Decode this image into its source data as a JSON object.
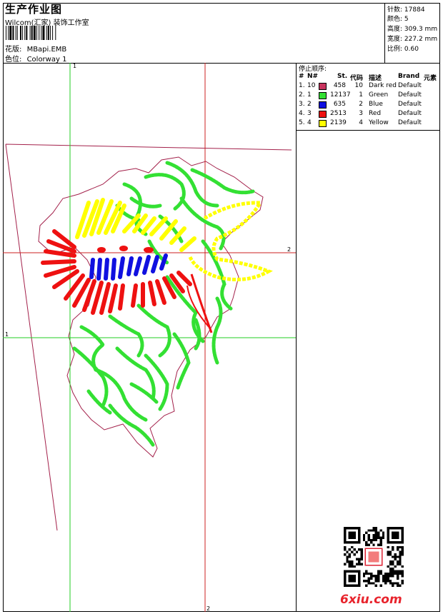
{
  "header": {
    "title": "生产作业图",
    "company": "Wilcom(汇家) 装饰工作室",
    "pattern_label": "花版:",
    "pattern_value": "MBapi.EMB",
    "colorway_label": "色位:",
    "colorway_value": "Colorway 1"
  },
  "stats": {
    "stitches_label": "针数:",
    "stitches_value": "17884",
    "colors_label": "颜色:",
    "colors_value": "5",
    "height_label": "高度:",
    "height_value": "309.3 mm",
    "width_label": "宽度:",
    "width_value": "227.2 mm",
    "scale_label": "比例:",
    "scale_value": "0.60"
  },
  "guides": {
    "v_green_label": "1",
    "h_green_label": "1",
    "h_red_label": "2",
    "v_red_label": "2"
  },
  "thread_table": {
    "title": "停止顺序:",
    "headers": {
      "index": "#",
      "n": "N#",
      "st": "St.",
      "code": "代码",
      "desc": "描述",
      "brand": "Brand",
      "element": "元素"
    },
    "rows": [
      {
        "index": "1.",
        "n": "10",
        "color": "#c8335e",
        "st": "458",
        "code": "10",
        "desc": "Dark red",
        "brand": "Default"
      },
      {
        "index": "2.",
        "n": "1",
        "color": "#33e033",
        "st": "12137",
        "code": "1",
        "desc": "Green",
        "brand": "Default"
      },
      {
        "index": "3.",
        "n": "2",
        "color": "#1010e0",
        "st": "635",
        "code": "2",
        "desc": "Blue",
        "brand": "Default"
      },
      {
        "index": "4.",
        "n": "3",
        "color": "#ee1111",
        "st": "2513",
        "code": "3",
        "desc": "Red",
        "brand": "Default"
      },
      {
        "index": "5.",
        "n": "4",
        "color": "#ffff00",
        "st": "2139",
        "code": "4",
        "desc": "Yellow",
        "brand": "Default"
      }
    ]
  },
  "footer": {
    "site_logo": "6xiu.com",
    "qr_icon": "qr-code-icon"
  }
}
